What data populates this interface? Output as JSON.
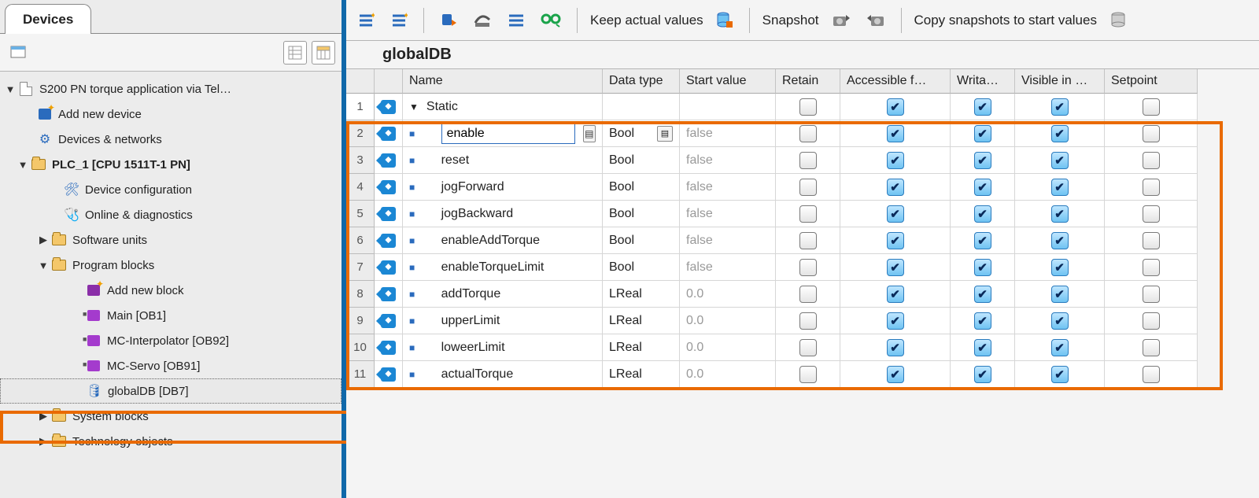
{
  "left": {
    "tab": "Devices",
    "tree": {
      "project": "S200 PN torque application via Tel…",
      "add_device": "Add new device",
      "networks": "Devices & networks",
      "plc": "PLC_1 [CPU 1511T-1 PN]",
      "device_config": "Device configuration",
      "online_diag": "Online & diagnostics",
      "software_units": "Software units",
      "program_blocks": "Program blocks",
      "add_block": "Add new block",
      "main": "Main [OB1]",
      "mc_interp": "MC-Interpolator [OB92]",
      "mc_servo": "MC-Servo [OB91]",
      "globaldb": "globalDB [DB7]",
      "system_blocks": "System blocks",
      "tech_objects": "Technology objects"
    }
  },
  "toolbar": {
    "keep_actual": "Keep actual values",
    "snapshot": "Snapshot",
    "copy_snapshots": "Copy snapshots to start values"
  },
  "db": {
    "title": "globalDB",
    "columns": {
      "name": "Name",
      "datatype": "Data type",
      "startvalue": "Start value",
      "retain": "Retain",
      "accessible": "Accessible f…",
      "writable": "Writa…",
      "visible": "Visible in …",
      "setpoint": "Setpoint"
    },
    "static_label": "Static",
    "rows": [
      {
        "n": 2,
        "name": "enable",
        "type": "Bool",
        "start": "false",
        "retain": false,
        "accessible": true,
        "writable": true,
        "visible": true,
        "setpoint": false,
        "selected": true
      },
      {
        "n": 3,
        "name": "reset",
        "type": "Bool",
        "start": "false",
        "retain": false,
        "accessible": true,
        "writable": true,
        "visible": true,
        "setpoint": false
      },
      {
        "n": 4,
        "name": "jogForward",
        "type": "Bool",
        "start": "false",
        "retain": false,
        "accessible": true,
        "writable": true,
        "visible": true,
        "setpoint": false
      },
      {
        "n": 5,
        "name": "jogBackward",
        "type": "Bool",
        "start": "false",
        "retain": false,
        "accessible": true,
        "writable": true,
        "visible": true,
        "setpoint": false
      },
      {
        "n": 6,
        "name": "enableAddTorque",
        "type": "Bool",
        "start": "false",
        "retain": false,
        "accessible": true,
        "writable": true,
        "visible": true,
        "setpoint": false
      },
      {
        "n": 7,
        "name": "enableTorqueLimit",
        "type": "Bool",
        "start": "false",
        "retain": false,
        "accessible": true,
        "writable": true,
        "visible": true,
        "setpoint": false
      },
      {
        "n": 8,
        "name": "addTorque",
        "type": "LReal",
        "start": "0.0",
        "retain": false,
        "accessible": true,
        "writable": true,
        "visible": true,
        "setpoint": false
      },
      {
        "n": 9,
        "name": "upperLimit",
        "type": "LReal",
        "start": "0.0",
        "retain": false,
        "accessible": true,
        "writable": true,
        "visible": true,
        "setpoint": false
      },
      {
        "n": 10,
        "name": "loweerLimit",
        "type": "LReal",
        "start": "0.0",
        "retain": false,
        "accessible": true,
        "writable": true,
        "visible": true,
        "setpoint": false
      },
      {
        "n": 11,
        "name": "actualTorque",
        "type": "LReal",
        "start": "0.0",
        "retain": false,
        "accessible": true,
        "writable": true,
        "visible": true,
        "setpoint": false
      }
    ]
  }
}
